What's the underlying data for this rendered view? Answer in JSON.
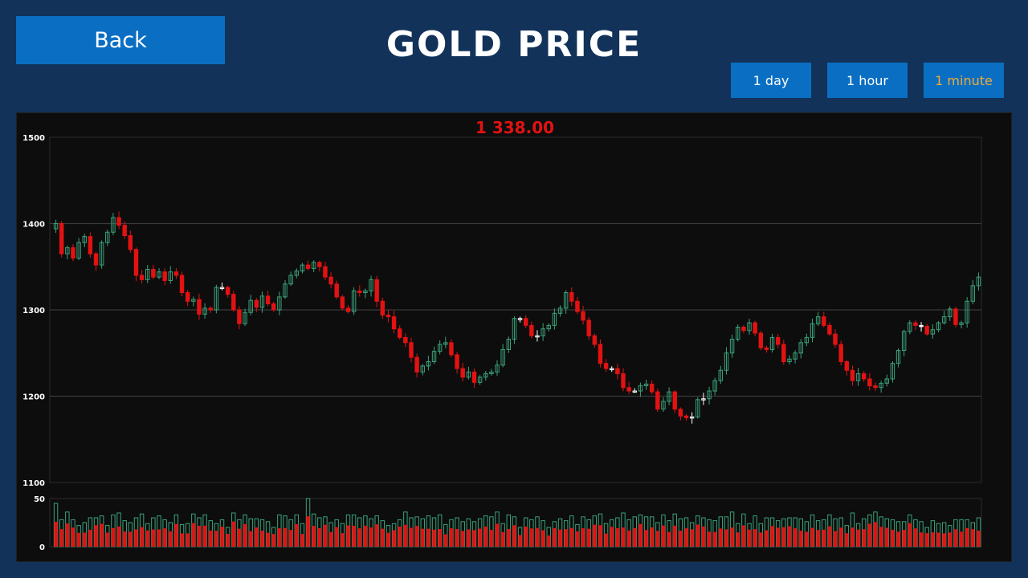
{
  "header": {
    "back_label": "Back",
    "title": "GOLD PRICE"
  },
  "timeframes": [
    {
      "label": "1 day",
      "active": false
    },
    {
      "label": "1 hour",
      "active": false
    },
    {
      "label": "1 minute",
      "active": true
    }
  ],
  "colors": {
    "background": "#12325a",
    "button": "#0a6fc3",
    "active_button_text": "#f0a93a",
    "up_candle": "#3aa27a",
    "down_candle": "#e31212",
    "doji": "#ffffff",
    "price_text": "#e31212"
  },
  "current_price": "1 338.00",
  "chart_data": {
    "type": "candlestick",
    "price_axis": {
      "ticks": [
        "1500",
        "1400",
        "1300",
        "1200",
        "1100"
      ],
      "ylim": [
        1100,
        1500
      ]
    },
    "volume_axis": {
      "ticks": [
        "50",
        "0"
      ],
      "ylim": [
        0,
        50
      ]
    },
    "grid": true,
    "closes": [
      1400,
      1365,
      1372,
      1360,
      1378,
      1385,
      1365,
      1352,
      1378,
      1390,
      1407,
      1398,
      1386,
      1370,
      1340,
      1335,
      1347,
      1338,
      1344,
      1334,
      1344,
      1340,
      1320,
      1310,
      1312,
      1295,
      1302,
      1300,
      1326,
      1326,
      1318,
      1300,
      1284,
      1297,
      1311,
      1303,
      1316,
      1307,
      1300,
      1315,
      1330,
      1340,
      1345,
      1352,
      1348,
      1355,
      1350,
      1338,
      1330,
      1315,
      1302,
      1298,
      1322,
      1320,
      1322,
      1335,
      1310,
      1294,
      1292,
      1278,
      1268,
      1262,
      1245,
      1228,
      1235,
      1240,
      1252,
      1260,
      1262,
      1248,
      1232,
      1222,
      1228,
      1216,
      1222,
      1226,
      1228,
      1236,
      1254,
      1266,
      1290,
      1290,
      1282,
      1270,
      1270,
      1278,
      1282,
      1296,
      1302,
      1320,
      1310,
      1298,
      1288,
      1270,
      1260,
      1238,
      1232,
      1232,
      1226,
      1210,
      1206,
      1206,
      1212,
      1214,
      1205,
      1185,
      1194,
      1205,
      1185,
      1177,
      1175,
      1176,
      1196,
      1197,
      1206,
      1218,
      1230,
      1250,
      1266,
      1280,
      1276,
      1285,
      1273,
      1256,
      1254,
      1268,
      1260,
      1240,
      1243,
      1250,
      1262,
      1268,
      1284,
      1292,
      1282,
      1272,
      1260,
      1240,
      1230,
      1218,
      1226,
      1220,
      1212,
      1210,
      1215,
      1220,
      1238,
      1253,
      1275,
      1285,
      1282,
      1281,
      1272,
      1277,
      1285,
      1292,
      1301,
      1283,
      1285,
      1310,
      1328,
      1338
    ],
    "volumes": [
      45,
      28,
      36,
      28,
      22,
      25,
      30,
      30,
      32,
      22,
      33,
      35,
      27,
      25,
      30,
      34,
      24,
      30,
      32,
      28,
      25,
      33,
      23,
      24,
      34,
      30,
      33,
      27,
      24,
      28,
      20,
      35,
      28,
      33,
      29,
      29,
      28,
      26,
      20,
      33,
      32,
      28,
      33,
      24,
      50,
      34,
      30,
      31,
      25,
      28,
      24,
      33,
      33,
      30,
      32,
      29,
      32,
      27,
      22,
      24,
      28,
      36,
      30,
      31,
      29,
      32,
      30,
      33,
      23,
      28,
      30,
      26,
      29,
      26,
      29,
      32,
      31,
      36,
      24,
      33,
      31,
      20,
      30,
      28,
      31,
      27,
      20,
      26,
      29,
      27,
      32,
      23,
      31,
      28,
      32,
      34,
      24,
      28,
      30,
      35,
      28,
      31,
      33,
      31,
      31,
      25,
      33,
      27,
      34,
      29,
      30,
      25,
      32,
      30,
      28,
      27,
      31,
      31,
      36,
      24,
      34,
      24,
      32,
      24,
      30,
      30,
      27,
      29,
      30,
      30,
      29,
      26,
      33,
      27,
      28,
      33,
      29,
      30,
      22,
      35,
      24,
      29,
      33,
      36,
      31,
      29,
      28,
      26,
      26,
      33,
      28,
      26,
      20,
      27,
      24,
      25,
      22,
      28,
      28,
      28,
      25,
      30,
      24,
      27,
      23,
      23
    ]
  }
}
